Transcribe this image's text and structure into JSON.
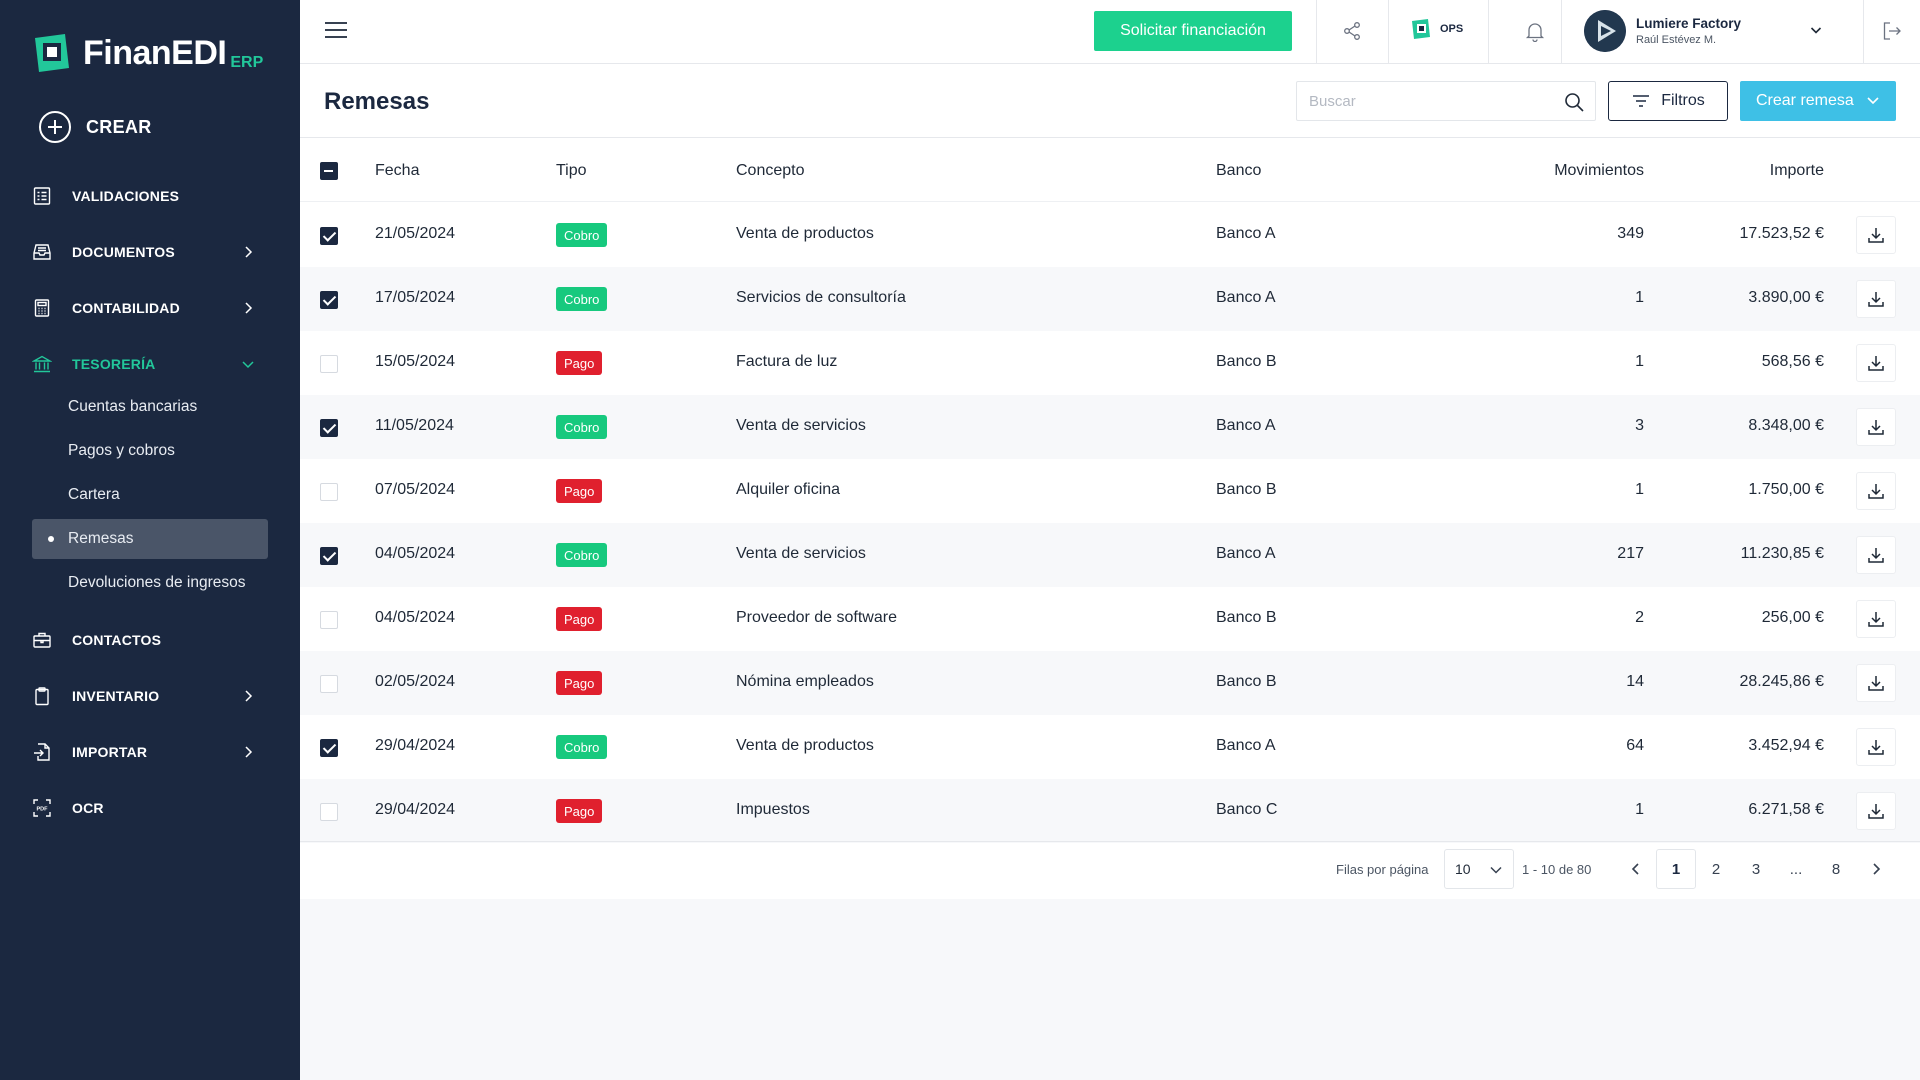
{
  "brand": {
    "name": "FinanEDI",
    "suffix": "ERP",
    "accent": "#22c79a",
    "sidebar_bg": "#1b2840"
  },
  "sidebar": {
    "create_label": "CREAR",
    "items": [
      {
        "label": "VALIDACIONES",
        "icon": "checklist-icon"
      },
      {
        "label": "DOCUMENTOS",
        "icon": "inbox-icon",
        "has_arrow": true
      },
      {
        "label": "CONTABILIDAD",
        "icon": "calculator-icon",
        "has_arrow": true
      },
      {
        "label": "TESORERÍA",
        "icon": "bank-icon",
        "expanded": true
      },
      {
        "label": "CONTACTOS",
        "icon": "briefcase-icon"
      },
      {
        "label": "INVENTARIO",
        "icon": "clipboard-icon",
        "has_arrow": true
      },
      {
        "label": "IMPORTAR",
        "icon": "import-icon",
        "has_arrow": true
      },
      {
        "label": "OCR",
        "icon": "pdf-scan-icon"
      }
    ],
    "subitems": [
      {
        "label": "Cuentas bancarias"
      },
      {
        "label": "Pagos y cobros"
      },
      {
        "label": "Cartera"
      },
      {
        "label": "Remesas",
        "selected": true
      },
      {
        "label": "Devoluciones de ingresos"
      }
    ]
  },
  "topbar": {
    "financiacion_label": "Solicitar financiación",
    "ops_label": "OPS",
    "company_name": "Lumiere Factory",
    "user_name": "Raúl Estévez M."
  },
  "page": {
    "title": "Remesas",
    "search_placeholder": "Buscar",
    "filters_label": "Filtros",
    "create_label": "Crear remesa"
  },
  "table": {
    "columns": {
      "fecha": "Fecha",
      "tipo": "Tipo",
      "concepto": "Concepto",
      "banco": "Banco",
      "movimientos": "Movimientos",
      "importe": "Importe"
    },
    "rows": [
      {
        "checked": true,
        "fecha": "21/05/2024",
        "tipo": "Cobro",
        "concepto": "Venta de productos",
        "banco": "Banco A",
        "movimientos": "349",
        "importe": "17.523,52 €"
      },
      {
        "checked": true,
        "fecha": "17/05/2024",
        "tipo": "Cobro",
        "concepto": "Servicios de consultoría",
        "banco": "Banco A",
        "movimientos": "1",
        "importe": "3.890,00 €"
      },
      {
        "checked": false,
        "fecha": "15/05/2024",
        "tipo": "Pago",
        "concepto": "Factura de luz",
        "banco": "Banco B",
        "movimientos": "1",
        "importe": "568,56 €"
      },
      {
        "checked": true,
        "fecha": "11/05/2024",
        "tipo": "Cobro",
        "concepto": "Venta de servicios",
        "banco": "Banco A",
        "movimientos": "3",
        "importe": "8.348,00 €"
      },
      {
        "checked": false,
        "fecha": "07/05/2024",
        "tipo": "Pago",
        "concepto": "Alquiler oficina",
        "banco": "Banco B",
        "movimientos": "1",
        "importe": "1.750,00 €"
      },
      {
        "checked": true,
        "fecha": "04/05/2024",
        "tipo": "Cobro",
        "concepto": "Venta de servicios",
        "banco": "Banco A",
        "movimientos": "217",
        "importe": "11.230,85 €"
      },
      {
        "checked": false,
        "fecha": "04/05/2024",
        "tipo": "Pago",
        "concepto": "Proveedor de software",
        "banco": "Banco B",
        "movimientos": "2",
        "importe": "256,00 €"
      },
      {
        "checked": false,
        "fecha": "02/05/2024",
        "tipo": "Pago",
        "concepto": "Nómina empleados",
        "banco": "Banco B",
        "movimientos": "14",
        "importe": "28.245,86 €"
      },
      {
        "checked": true,
        "fecha": "29/04/2024",
        "tipo": "Cobro",
        "concepto": "Venta de productos",
        "banco": "Banco A",
        "movimientos": "64",
        "importe": "3.452,94 €"
      },
      {
        "checked": false,
        "fecha": "29/04/2024",
        "tipo": "Pago",
        "concepto": "Impuestos",
        "banco": "Banco C",
        "movimientos": "1",
        "importe": "6.271,58 €"
      }
    ],
    "type_colors": {
      "Cobro": "#17c97e",
      "Pago": "#e0202e"
    }
  },
  "pagination": {
    "rows_label": "Filas por página",
    "rows_value": "10",
    "range": "1 - 10 de 80",
    "pages": [
      "1",
      "2",
      "3",
      "...",
      "8"
    ],
    "current": "1"
  }
}
